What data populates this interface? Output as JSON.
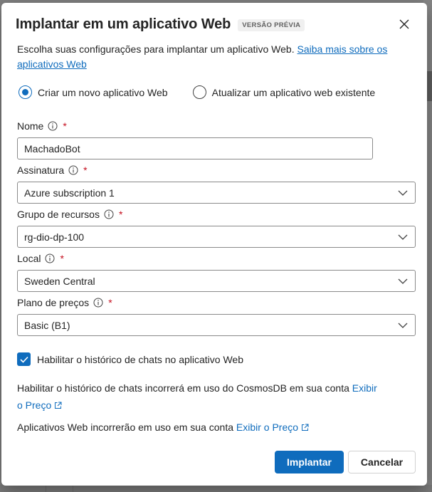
{
  "dialog": {
    "title": "Implantar em um aplicativo Web",
    "badge": "VERSÃO PRÉVIA",
    "close_icon": "close-icon",
    "description_text": "Escolha suas configurações para implantar um aplicativo Web. ",
    "description_link": "Saiba mais sobre os aplicativos Web"
  },
  "mode": {
    "options": [
      {
        "label": "Criar um novo aplicativo Web",
        "selected": true
      },
      {
        "label": "Atualizar um aplicativo web existente",
        "selected": false
      }
    ]
  },
  "fields": {
    "name": {
      "label": "Nome",
      "value": "MachadoBot"
    },
    "subscription": {
      "label": "Assinatura",
      "value": "Azure subscription 1"
    },
    "resource_group": {
      "label": "Grupo de recursos",
      "value": "rg-dio-dp-100"
    },
    "location": {
      "label": "Local",
      "value": "Sweden Central"
    },
    "pricing_plan": {
      "label": "Plano de preços",
      "value": "Basic (B1)"
    },
    "required_marker": "*"
  },
  "chat_history": {
    "label": "Habilitar o histórico de chats no aplicativo Web",
    "checked": true
  },
  "notes": {
    "cosmos_text": "Habilitar o histórico de chats incorrerá em uso do CosmosDB em sua conta ",
    "cosmos_link_part1": "Exibir",
    "cosmos_link_part2": "o Preço",
    "webapp_text": "Aplicativos Web incorrerão em uso em sua conta ",
    "webapp_link": "Exibir o Preço"
  },
  "buttons": {
    "deploy": "Implantar",
    "cancel": "Cancelar"
  },
  "colors": {
    "accent": "#0f6cbd",
    "required": "#c50f1f"
  }
}
